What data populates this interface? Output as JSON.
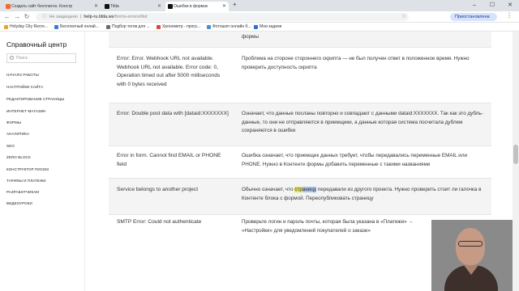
{
  "browser": {
    "tabs": [
      {
        "title": "Создать сайт бесплатно. Констр",
        "active": false,
        "fav_color": "#f06a35"
      },
      {
        "title": "Tilda",
        "active": false,
        "fav_color": "#111111"
      },
      {
        "title": "Ошибки в формах",
        "active": true,
        "fav_color": "#111111"
      }
    ],
    "new_tab": "+",
    "window_controls": {
      "minimize": "–",
      "maximize": "☐",
      "close": "✕"
    },
    "nav": {
      "back": "←",
      "forward": "→",
      "reload": "↻"
    },
    "address": {
      "security_label": "Не защищено",
      "host": "help-ru.tilda.ws",
      "path": "/forms-errors#list"
    },
    "star": "☆",
    "profile_label": "Приостановлена",
    "menu": "⋮"
  },
  "bookmarks": [
    {
      "label": "Holyday City Recre...",
      "color": "#e8a33a"
    },
    {
      "label": "Бесплатный онлай...",
      "color": "#3e7bd6"
    },
    {
      "label": "Подбор тегов для ...",
      "color": "#6c6c6c"
    },
    {
      "label": "Хронометр - прогр...",
      "color": "#d94c3d"
    },
    {
      "label": "Фотошоп онлайн б...",
      "color": "#4a8fd6"
    },
    {
      "label": "Мои задачи",
      "color": "#2a6fd6"
    }
  ],
  "sidebar": {
    "title": "Справочный центр",
    "search_placeholder": "Поиск",
    "items": [
      "НАЧАЛО РАБОТЫ",
      "НАСТРОЙКИ САЙТА",
      "РЕДАКТИРОВАНИЕ СТРАНИЦЫ",
      "ИНТЕРНЕТ-МАГАЗИН",
      "ФОРМЫ",
      "АНАЛИТИКА",
      "SEO",
      "ZERO BLOCK",
      "КОНСТРУКТОР ПИСЕМ",
      "ТАРИФЫ И ПЛАТЕЖИ",
      "РАЗРАБОТЧИКАМ",
      "ВИДЕОУРОКИ"
    ]
  },
  "table": {
    "top_fragment": "формы",
    "rows": [
      {
        "error": "Error: Error. Webhook URL not available. Webhook URL not available. Error code: 0, Operation timed out after 5000 milliseconds with 0 bytes received",
        "description": "Проблема на стороне стороннего скрипта — не был получен ответ в положенное время. Нужно проверить доступность скрипта"
      },
      {
        "error": "Error: Double post data with [dataid:XXXXXXX]",
        "description": "Означает, что данные посланы повторно и совпадают с данными dataid:XXXXXXX. Так как это дубль-данные, то они не отправляются в приемщики, а данные которая система посчитала дублем сохраняются в ошибке"
      },
      {
        "error": "Error in form. Cannot find EMAIL or PHONE field",
        "description": "Ошибка означает, что приемщик данных требует, чтобы передавались переменные EMAIL или PHONE. Нужно в Контенте формы добавить переменные с такими названиями"
      },
      {
        "error": "Service belongs to another project",
        "description_before": "Обычно означает, что ",
        "description_hl1": "стр",
        "description_hl2": "аницу",
        "description_after": " передавали из другого проекта. Нужно проверить стоит ли галочка в Контенте блока с формой. Переопубликовать страницу"
      },
      {
        "error": "SMTP Error: Could not authenticate",
        "description": "Проверьте логин и пароль почты, которая была указана в «Платежи» → «Настройки» для уведомлений покупателей о заказе»"
      }
    ]
  }
}
